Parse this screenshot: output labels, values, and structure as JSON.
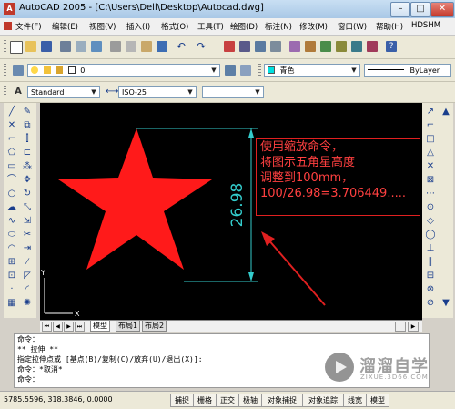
{
  "window": {
    "app_icon_text": "A",
    "title": "AutoCAD 2005 - [C:\\Users\\Dell\\Desktop\\Autocad.dwg]",
    "minimize": "–",
    "maximize": "□",
    "close": "✕"
  },
  "menu": {
    "items": [
      "文件(F)",
      "编辑(E)",
      "视图(V)",
      "插入(I)",
      "格式(O)",
      "工具(T)",
      "绘图(D)",
      "标注(N)",
      "修改(M)",
      "窗口(W)",
      "帮助(H)",
      "HDSHM"
    ]
  },
  "layer_toolbar": {
    "layer_value": "0",
    "color_value": "青色",
    "linetype_value": "ByLayer"
  },
  "style_toolbar": {
    "text_style": "Standard",
    "dim_style": "ISO-25"
  },
  "drawing": {
    "dimension_text": "26.98",
    "ucs_x": "X",
    "ucs_y": "Y",
    "star_color": "#ff1a1a",
    "dim_color": "#33cccc"
  },
  "annotation": {
    "lines": [
      "使用缩放命令，",
      "将图示五角星高度",
      "调整到100mm，",
      "100/26.98=3.706449....."
    ]
  },
  "tabs": {
    "items": [
      "模型",
      "布局1",
      "布局2"
    ]
  },
  "command_line": {
    "lines": [
      "命令：",
      "** 拉伸 **",
      "指定拉伸点或 [基点(B)/复制(C)/放弃(U)/退出(X)]:",
      "命令：*取消*",
      "命令："
    ]
  },
  "status": {
    "coords": "5785.5596, 318.3846, 0.0000",
    "buttons": [
      "捕捉",
      "栅格",
      "正交",
      "极轴",
      "对象捕捉",
      "对象追踪",
      "线宽",
      "模型"
    ]
  },
  "watermark": {
    "text": "溜溜自学",
    "sub": "ZIXUE.3D66.COM"
  }
}
